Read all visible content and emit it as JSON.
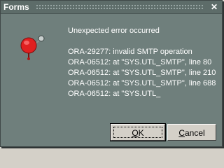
{
  "window": {
    "title": "Forms",
    "close_glyph": "✕"
  },
  "icon": {
    "name": "alarm-bell-icon",
    "color": "#e02020"
  },
  "message": {
    "heading": "Unexpected error occurred",
    "lines": [
      "ORA-29277: invalid SMTP operation",
      "ORA-06512: at \"SYS.UTL_SMTP\", line 80",
      "ORA-06512: at \"SYS.UTL_SMTP\", line 210",
      "ORA-06512: at \"SYS.UTL_SMTP\", line 688",
      "ORA-06512: at \"SYS.UTL_"
    ]
  },
  "buttons": {
    "ok": {
      "accel": "O",
      "rest": "K"
    },
    "cancel": {
      "accel": "C",
      "rest": "ancel"
    }
  },
  "colors": {
    "dialog_bg": "#6f7f7c",
    "titlebar_bg": "#5d6c69",
    "text": "#ffffff"
  }
}
